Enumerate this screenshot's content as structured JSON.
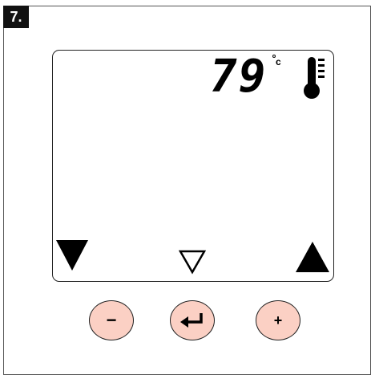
{
  "step": {
    "label": "7."
  },
  "display": {
    "temperature": "79",
    "unit": "c",
    "icon": "thermometer-icon",
    "left_arrow": "triangle-down-filled",
    "center_arrow": "triangle-down-outline",
    "right_arrow": "triangle-up-filled"
  },
  "buttons": {
    "minus_label": "−",
    "enter_icon": "enter-icon",
    "plus_label": "+"
  },
  "colors": {
    "button_fill": "#fbd0c4",
    "badge_bg": "#111111"
  }
}
